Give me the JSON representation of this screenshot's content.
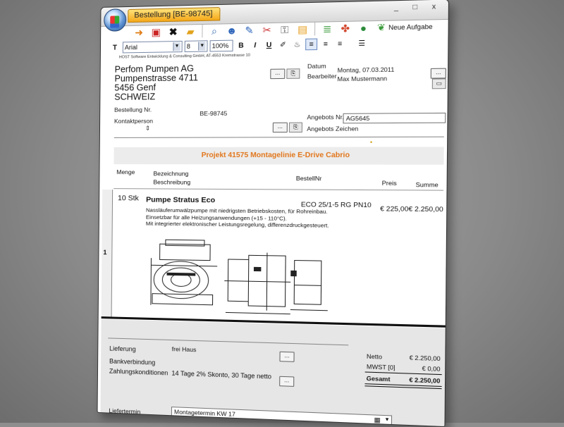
{
  "window": {
    "tab_title": "Bestellung [BE-98745]",
    "controls": "_ □ x"
  },
  "toolbar": {
    "new_task_label": "Neue Aufgabe",
    "icons": [
      "arrow-right-icon",
      "save-icon",
      "delete-icon",
      "folder-icon",
      "search-icon",
      "users-icon",
      "pencil-icon",
      "tools-icon",
      "lock-icon",
      "document-icon",
      "layers-icon",
      "puzzle-icon",
      "globe-icon",
      "leaf-icon"
    ]
  },
  "formatbar": {
    "font": "Arial",
    "size": "8",
    "zoom": "100%",
    "bold": "B",
    "italic": "I",
    "underline": "U"
  },
  "company_line": "HOST Software Entwicklung & Consulting GmbH, AT-4553 Kremstrasse 10",
  "address": {
    "line1": "Perfom Pumpen AG",
    "line2": "Pumpenstrasse 4711",
    "line3": "5456 Genf",
    "line4": "SCHWEIZ"
  },
  "header_fields": {
    "datum_label": "Datum",
    "datum_value": "Montag, 07.03.2011",
    "bearbeiter_label": "Bearbeiter",
    "bearbeiter_value": "Max Mustermann",
    "bestellung_label": "Bestellung Nr.",
    "bestellung_value": "BE-98745",
    "kontakt_label": "Kontaktperson",
    "angebot_label": "Angebots Nr.",
    "angebot_value": "AG5645",
    "angebot_zeichen_label": "Angebots Zeichen",
    "dots": "..."
  },
  "project_title": "Projekt 41575 Montagelinie E-Drive Cabrio",
  "table": {
    "col_menge": "Menge",
    "col_bezeichnung": "Bezeichnung",
    "col_bestellnr": "BestellNr",
    "col_beschreibung": "Beschreibung",
    "col_preis": "Preis",
    "col_summe": "Summe"
  },
  "item": {
    "row_number": "1",
    "qty": "10 Stk",
    "title": "Pumpe Stratus Eco",
    "article": "ECO 25/1-5 RG PN10",
    "price": "€ 225,00",
    "sum": "€ 2.250,00",
    "desc1": "Nassläuferumwälzpumpe mit niedrigsten Betriebskosten, für Rohreinbau.",
    "desc2": "Einsetzbar für alle Heizungsanwendungen (+15 - 110°C).",
    "desc3": "Mit integrierter elektronischer Leistungsregelung, differenzdruckgesteuert."
  },
  "footer": {
    "lieferung_label": "Lieferung",
    "lieferung_value": "frei Haus",
    "bank_label": "Bankverbindung",
    "zahlung_label": "Zahlungskonditionen",
    "zahlung_value": "14 Tage 2% Skonto, 30 Tage netto",
    "liefertermin_label": "Liefertermin",
    "liefertermin_value": "Montagetermin KW 17",
    "dots": "..."
  },
  "totals": {
    "netto_label": "Netto",
    "netto_value": "€ 2.250,00",
    "mwst_label": "MWST [0]",
    "mwst_value": "€ 0,00",
    "gesamt_label": "Gesamt",
    "gesamt_value": "€ 2.250,00"
  }
}
